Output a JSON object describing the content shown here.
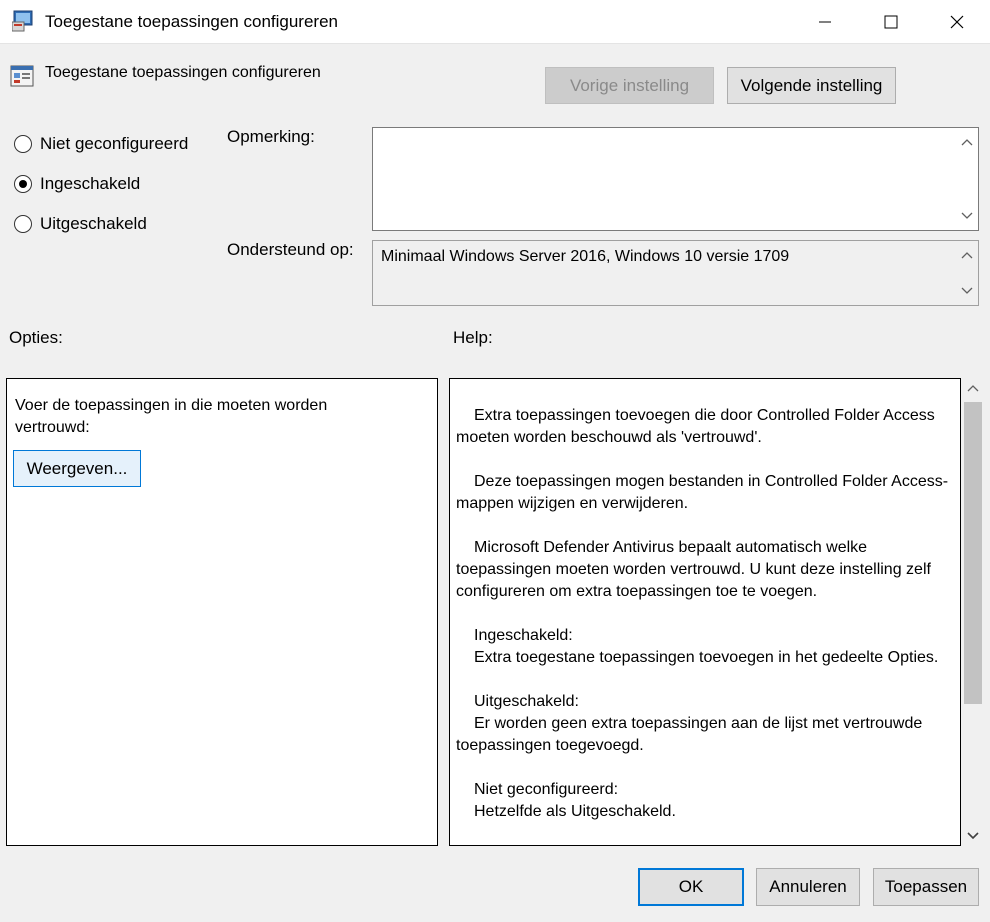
{
  "window": {
    "title": "Toegestane toepassingen configureren",
    "controls": [
      "minimize",
      "maximize",
      "close"
    ]
  },
  "policy": {
    "title": "Toegestane toepassingen configureren",
    "prev_button": "Vorige instelling",
    "next_button": "Volgende instelling"
  },
  "state": {
    "options": [
      {
        "label": "Niet geconfigureerd",
        "checked": false
      },
      {
        "label": "Ingeschakeld",
        "checked": true
      },
      {
        "label": "Uitgeschakeld",
        "checked": false
      }
    ]
  },
  "comment": {
    "label": "Opmerking:",
    "value": ""
  },
  "supported": {
    "label": "Ondersteund op:",
    "value": "Minimaal Windows Server 2016, Windows 10 versie 1709"
  },
  "options_section": {
    "label": "Opties:",
    "description": "Voer de toepassingen in die moeten worden vertrouwd:",
    "show_button": "Weergeven..."
  },
  "help_section": {
    "label": "Help:",
    "paragraphs": [
      "Extra toepassingen toevoegen die door Controlled Folder Access moeten worden beschouwd als 'vertrouwd'.",
      "Deze toepassingen mogen bestanden in Controlled Folder Access-mappen wijzigen en verwijderen.",
      "Microsoft Defender Antivirus bepaalt automatisch welke toepassingen moeten worden vertrouwd. U kunt deze instelling zelf configureren om extra toepassingen toe te voegen."
    ],
    "enabled_heading": "Ingeschakeld:",
    "enabled_text": "Extra toegestane toepassingen toevoegen in het gedeelte Opties.",
    "disabled_heading": "Uitgeschakeld:",
    "disabled_text": "Er worden geen extra toepassingen aan de lijst met vertrouwde toepassingen toegevoegd.",
    "notconfigured_heading": "Niet geconfigureerd:",
    "notconfigured_text": "Hetzelfde als Uitgeschakeld."
  },
  "footer": {
    "ok": "OK",
    "cancel": "Annuleren",
    "apply": "Toepassen"
  },
  "colors": {
    "accent": "#0078d7",
    "window_bg": "#f0f0f0"
  }
}
